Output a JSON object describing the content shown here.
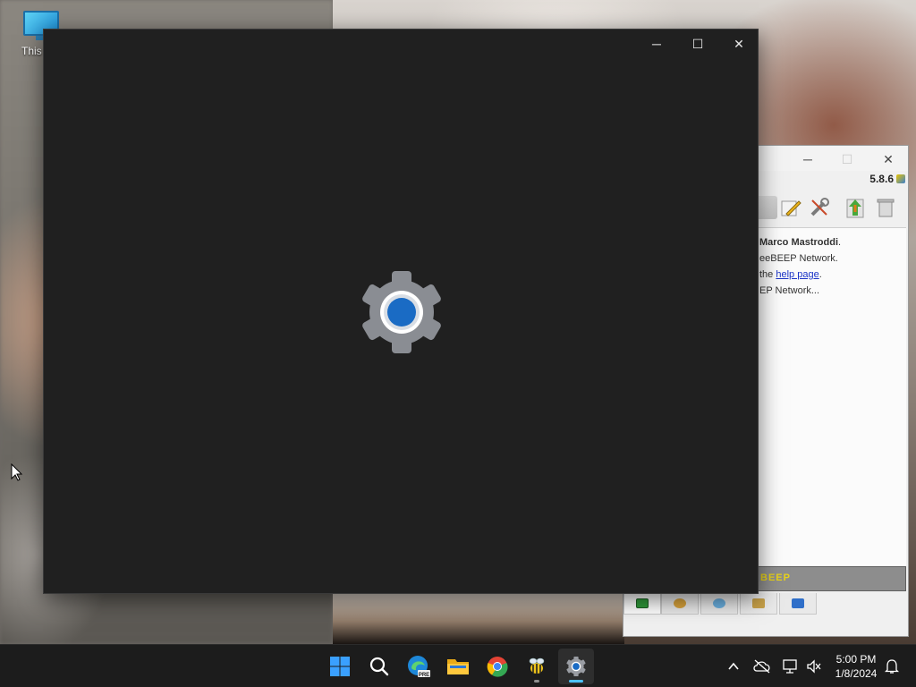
{
  "desktop": {
    "icons": [
      {
        "label": "This P",
        "icon": "this-pc-icon"
      }
    ]
  },
  "beebeep_window": {
    "title_buttons": {
      "minimize": "─",
      "maximize": "☐",
      "close": "✕"
    },
    "version": "5.8.6",
    "toolbar_icons": [
      "mail-icon",
      "edit-pencil-icon",
      "tools-icon",
      "update-icon",
      "delete-icon"
    ],
    "welcome_lines": [
      {
        "text": "Marco Mastroddi",
        "suffix": "."
      },
      {
        "text": "eeBEEP Network."
      },
      {
        "prefix": "the ",
        "link": "help page",
        "suffix": "."
      },
      {
        "text": "EP Network..."
      }
    ],
    "banner_text": "BEEP",
    "bottom_tabs": [
      "chat-tab-icon",
      "users-tab-icon",
      "groups-tab-icon",
      "network-tab-icon",
      "share-tab-icon"
    ]
  },
  "settings_window": {
    "caption_buttons": {
      "minimize": "─",
      "maximize": "☐",
      "close": "✕"
    },
    "splash_icon": "settings-gear-icon",
    "colors": {
      "background": "#202020",
      "gear": "#8a8d93",
      "gear_center": "#1a6bc4"
    }
  },
  "taskbar": {
    "apps": [
      {
        "name": "start",
        "icon": "windows-start-icon"
      },
      {
        "name": "search",
        "icon": "search-icon"
      },
      {
        "name": "edge-preview",
        "icon": "edge-pre-icon",
        "badge": "PRE"
      },
      {
        "name": "file-explorer",
        "icon": "folder-icon"
      },
      {
        "name": "chrome",
        "icon": "chrome-icon"
      },
      {
        "name": "beebeep",
        "icon": "bee-icon"
      },
      {
        "name": "settings",
        "icon": "settings-gear-icon",
        "active": true
      }
    ],
    "tray": {
      "overflow_icon": "chevron-up-icon",
      "onedrive_icon": "cloud-offline-icon",
      "network_icon": "network-icon",
      "volume_icon": "volume-muted-icon",
      "notifications_icon": "bell-icon"
    },
    "clock": {
      "time": "5:00 PM",
      "date": "1/8/2024"
    }
  }
}
